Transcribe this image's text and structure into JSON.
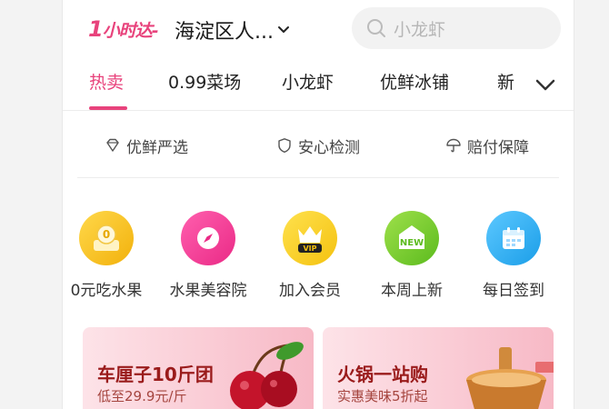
{
  "header": {
    "logo_main": "1",
    "logo_text": "小时达",
    "location": "海淀区人...",
    "search_placeholder": "小龙虾"
  },
  "tabs": [
    {
      "label": "热卖",
      "active": true
    },
    {
      "label": "0.99菜场",
      "active": false
    },
    {
      "label": "小龙虾",
      "active": false
    },
    {
      "label": "优鲜冰铺",
      "active": false
    },
    {
      "label": "新",
      "active": false
    }
  ],
  "guarantees": [
    {
      "label": "优鲜严选",
      "icon": "diamond-icon"
    },
    {
      "label": "安心检测",
      "icon": "shield-icon"
    },
    {
      "label": "赔付保障",
      "icon": "umbrella-icon"
    }
  ],
  "features": [
    {
      "label": "0元吃水果",
      "icon": "coin-icon",
      "badge": "0",
      "color": "#f6c21c"
    },
    {
      "label": "水果美容院",
      "icon": "compass-icon",
      "color": "#f0399a"
    },
    {
      "label": "加入会员",
      "icon": "crown-vip-icon",
      "badge": "VIP",
      "color": "#f7cf1a"
    },
    {
      "label": "本周上新",
      "icon": "new-house-icon",
      "badge": "NEW",
      "color": "#74cc2c"
    },
    {
      "label": "每日签到",
      "icon": "calendar-icon",
      "color": "#33b1f2"
    }
  ],
  "cards": [
    {
      "title": "车厘子10斤团",
      "subtitle": "低至29.9元/斤",
      "image": "cherries-image"
    },
    {
      "title": "火锅一站购",
      "subtitle": "实惠美味5折起",
      "image": "hotpot-image"
    }
  ],
  "colors": {
    "accent": "#e8437c",
    "text": "#1a1a1a",
    "muted": "#b6b6b6"
  }
}
